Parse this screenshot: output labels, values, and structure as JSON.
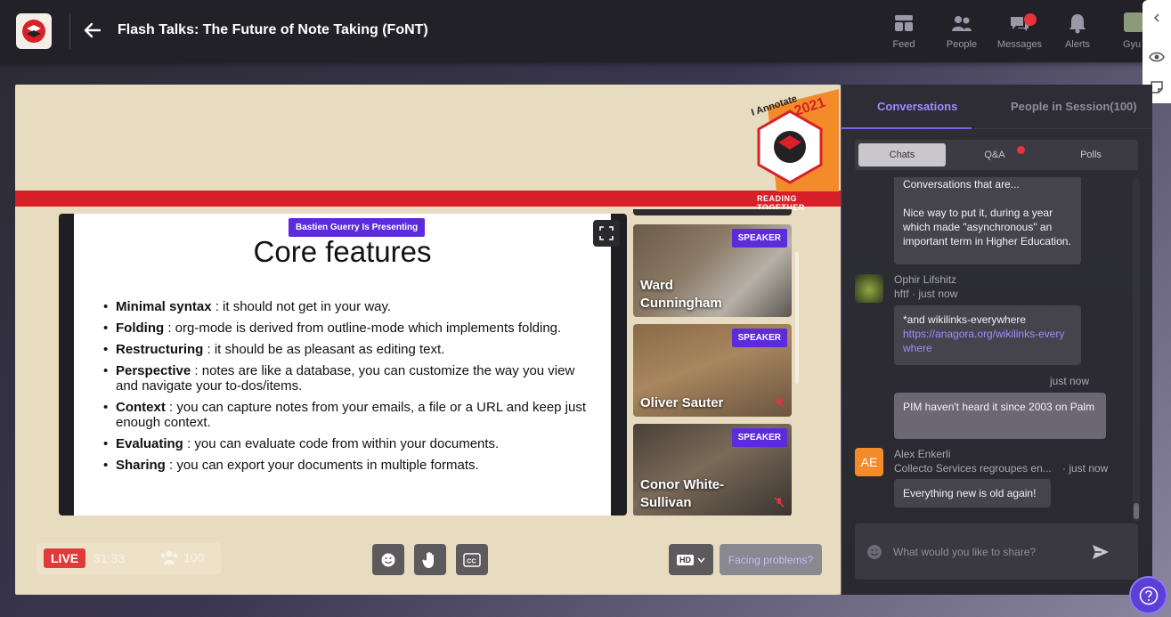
{
  "header": {
    "title": "Flash Talks: The Future of Note Taking (FoNT)",
    "nav": [
      {
        "label": "Feed",
        "icon": "feed-icon"
      },
      {
        "label": "People",
        "icon": "people-icon"
      },
      {
        "label": "Messages",
        "icon": "messages-icon"
      },
      {
        "label": "Alerts",
        "icon": "alerts-icon"
      }
    ],
    "user_label": "Gyu"
  },
  "banner": {
    "brand": "I Annotate",
    "year": "2021",
    "tagline": "READING TOGETHER"
  },
  "slide": {
    "presenting": "Bastien Guerry Is Presenting",
    "title": "Core features",
    "items": [
      {
        "term": "Minimal syntax",
        "text": " : it should not get in your way."
      },
      {
        "term": "Folding",
        "text": " : org-mode is derived from outline-mode which implements folding."
      },
      {
        "term": "Restructuring",
        "text": " : it should be as pleasant as editing text."
      },
      {
        "term": "Perspective",
        "text": " : notes are like a database, you can customize the way you view and navigate your to-dos/items."
      },
      {
        "term": "Context",
        "text": " : you can capture notes from your emails, a file or a URL and keep just enough context."
      },
      {
        "term": "Evaluating",
        "text": " : you can evaluate code from within your documents."
      },
      {
        "term": "Sharing",
        "text": " : you can export your documents in multiple formats."
      }
    ]
  },
  "speakers": [
    {
      "name_line1": "Ward",
      "name_line2": "Cunningham",
      "badge": "SPEAKER"
    },
    {
      "name_line1": "Oliver Sauter",
      "name_line2": "",
      "badge": "SPEAKER"
    },
    {
      "name_line1": "Conor White-",
      "name_line2": "Sullivan",
      "badge": "SPEAKER"
    }
  ],
  "stage_bar": {
    "live": "LIVE",
    "time": "31:33",
    "viewers": "100",
    "quality": "HD",
    "facing_problems": "Facing problems?"
  },
  "sidebar": {
    "tabs": [
      "Conversations",
      "People in Session(100)"
    ],
    "subtabs": [
      "Chats",
      "Q&A",
      "Polls"
    ],
    "messages": {
      "m1_cut": "Conversations that are...",
      "m1_text": "Nice way to put it, during a year which made \"asynchronous\" an important term in Higher Education.",
      "m2_name": "Ophir Lifshitz",
      "m2_sub": "hftf · just now",
      "m2_text": "*and wikilinks-everywhere",
      "m2_link": "https://anagora.org/wikilinks-everywhere",
      "m3_time": "just now",
      "m3_text": "PIM haven't heard it since 2003 on Palm",
      "m4_initials": "AE",
      "m4_name": "Alex Enkerli",
      "m4_sub": "Collecto Services regroupes en...",
      "m4_time": "· just now",
      "m4_text": "Everything new is old again!"
    },
    "composer_placeholder": "What would you like to share?"
  },
  "colors": {
    "accent": "#5b2bdc",
    "live": "#e03a3a",
    "stage_bg": "#e8dcc0",
    "banner_red": "#d82028"
  }
}
